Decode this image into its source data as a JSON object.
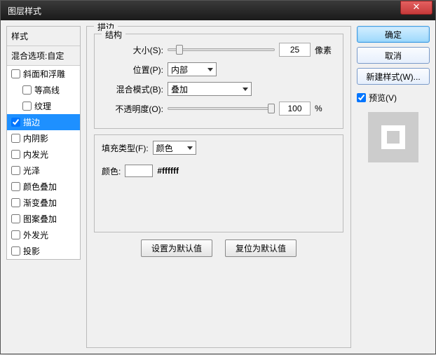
{
  "window": {
    "title": "图层样式"
  },
  "left": {
    "header": "样式",
    "blend_options": "混合选项:自定",
    "items": [
      {
        "label": "斜面和浮雕",
        "checked": false,
        "indent": false
      },
      {
        "label": "等高线",
        "checked": false,
        "indent": true
      },
      {
        "label": "纹理",
        "checked": false,
        "indent": true
      },
      {
        "label": "描边",
        "checked": true,
        "indent": false,
        "selected": true
      },
      {
        "label": "内阴影",
        "checked": false,
        "indent": false
      },
      {
        "label": "内发光",
        "checked": false,
        "indent": false
      },
      {
        "label": "光泽",
        "checked": false,
        "indent": false
      },
      {
        "label": "颜色叠加",
        "checked": false,
        "indent": false
      },
      {
        "label": "渐变叠加",
        "checked": false,
        "indent": false
      },
      {
        "label": "图案叠加",
        "checked": false,
        "indent": false
      },
      {
        "label": "外发光",
        "checked": false,
        "indent": false
      },
      {
        "label": "投影",
        "checked": false,
        "indent": false
      }
    ]
  },
  "center": {
    "section_title": "描边",
    "structure_title": "结构",
    "size_label": "大小(S):",
    "size_value": "25",
    "size_unit": "像素",
    "position_label": "位置(P):",
    "position_value": "内部",
    "blend_mode_label": "混合模式(B):",
    "blend_mode_value": "叠加",
    "opacity_label": "不透明度(O):",
    "opacity_value": "100",
    "opacity_unit": "%",
    "fill_type_label": "填充类型(F):",
    "fill_type_value": "颜色",
    "color_label": "颜色:",
    "color_value": "#ffffff",
    "set_default": "设置为默认值",
    "reset_default": "复位为默认值"
  },
  "right": {
    "ok": "确定",
    "cancel": "取消",
    "new_style": "新建样式(W)...",
    "preview_label": "预览(V)",
    "preview_checked": true
  }
}
